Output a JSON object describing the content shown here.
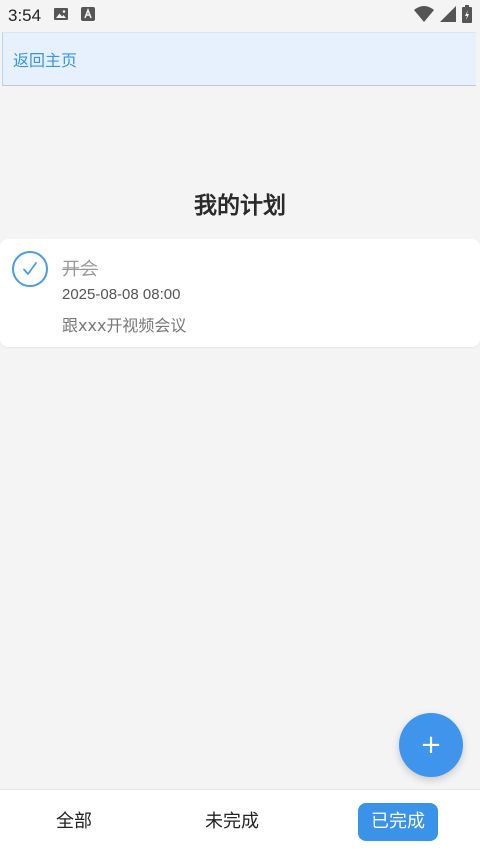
{
  "status_bar": {
    "time": "3:54",
    "icons": [
      "image-icon",
      "text-a-icon",
      "wifi-icon",
      "signal-icon",
      "battery-icon"
    ]
  },
  "nav": {
    "back_label": "返回主页"
  },
  "page": {
    "title": "我的计划"
  },
  "plans": [
    {
      "title": "开会",
      "datetime": "2025-08-08 08:00",
      "description": "跟xxx开视频会议",
      "completed": true
    }
  ],
  "fab": {
    "label": "+"
  },
  "tabs": [
    {
      "label": "全部",
      "active": false
    },
    {
      "label": "未完成",
      "active": false
    },
    {
      "label": "已完成",
      "active": true
    }
  ],
  "colors": {
    "accent": "#3a93e8",
    "background": "#f4f4f4",
    "back_bar": "#e6f1fd"
  }
}
